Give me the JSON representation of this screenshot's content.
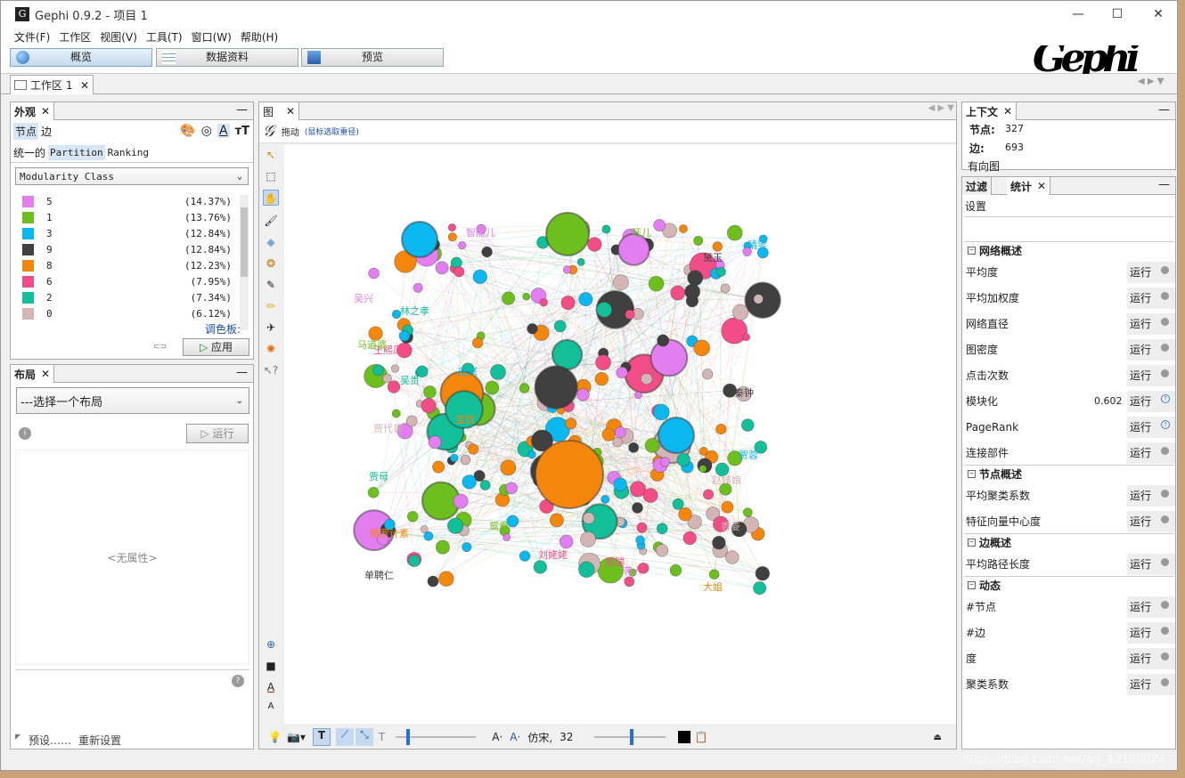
{
  "window": {
    "title": "Gephi 0.9.2 - 项目 1",
    "app_icon_glyph": "G",
    "minimize": "—",
    "maximize": "☐",
    "close": "✕"
  },
  "menu": [
    "文件(F)",
    "工作区",
    "视图(V)",
    "工具(T)",
    "窗口(W)",
    "帮助(H)"
  ],
  "modes": {
    "overview": "概览",
    "data_lab": "数据资料",
    "preview": "预览"
  },
  "logo_text": "Gephi",
  "workspace_tab": "工作区 1",
  "appearance": {
    "tab_title": "外观",
    "node_tab": "节点",
    "edge_tab": "边",
    "subtabs": [
      "统一的",
      "Partition",
      "Ranking"
    ],
    "attribute": "Modularity Class",
    "palette_link": "调色板:",
    "apply_label": "应用",
    "legend": [
      {
        "label": "5",
        "pct": "(14.37%)",
        "color": "#e27ef0"
      },
      {
        "label": "1",
        "pct": "(13.76%)",
        "color": "#6cbf1d"
      },
      {
        "label": "3",
        "pct": "(12.84%)",
        "color": "#0ab7ef"
      },
      {
        "label": "9",
        "pct": "(12.84%)",
        "color": "#404040"
      },
      {
        "label": "8",
        "pct": "(12.23%)",
        "color": "#f5860c"
      },
      {
        "label": "6",
        "pct": "(7.95%)",
        "color": "#f24d86"
      },
      {
        "label": "2",
        "pct": "(7.34%)",
        "color": "#13bf99"
      },
      {
        "label": "0",
        "pct": "(6.12%)",
        "color": "#d3b5b5"
      }
    ]
  },
  "layout": {
    "tab_title": "布局",
    "select_placeholder": "---选择一个布局",
    "run_label": "运行",
    "no_properties": "<无属性>",
    "presets": "预设……",
    "reset": "重新设置"
  },
  "graph": {
    "tab_title": "图",
    "mode": "拖动",
    "hint": "(鼠标选取重径)",
    "font_name": "仿宋,",
    "font_size": "32",
    "labels": [
      "智能儿",
      "旺儿",
      "晴雯",
      "黛玉",
      "宝钗",
      "王熙凤",
      "贾母",
      "贾代善",
      "吴兴",
      "马道婆",
      "应兴",
      "单聘仁",
      "晴罗计素",
      "刘姥姥",
      "吴贵",
      "香菱",
      "袭人",
      "鸳鸯",
      "贾蓉",
      "秦钟",
      "大姐",
      "周瑞",
      "林之孝",
      "赵姨娘"
    ]
  },
  "context": {
    "tab_title": "上下文",
    "nodes_label": "节点:",
    "nodes_value": "327",
    "edges_label": "边:",
    "edges_value": "693",
    "graph_type": "有向图"
  },
  "stats": {
    "filter_tab": "过滤",
    "stats_tab": "统计",
    "settings": "设置",
    "run": "运行",
    "sections": [
      {
        "title": "网络概述",
        "items": [
          {
            "name": "平均度"
          },
          {
            "name": "平均加权度"
          },
          {
            "name": "网络直径"
          },
          {
            "name": "图密度"
          },
          {
            "name": "点击次数"
          },
          {
            "name": "模块化",
            "value": "0.602",
            "help": true
          },
          {
            "name": "PageRank",
            "help": true
          },
          {
            "name": "连接部件"
          }
        ]
      },
      {
        "title": "节点概述",
        "items": [
          {
            "name": "平均聚类系数"
          },
          {
            "name": "特征向量中心度"
          }
        ]
      },
      {
        "title": "边概述",
        "items": [
          {
            "name": "平均路径长度"
          }
        ]
      },
      {
        "title": "动态",
        "items": [
          {
            "name": "#节点"
          },
          {
            "name": "#边"
          },
          {
            "name": "度"
          },
          {
            "name": "聚类系数"
          }
        ]
      }
    ]
  },
  "watermark": "https://blog.csdn.net/qq_42198024"
}
